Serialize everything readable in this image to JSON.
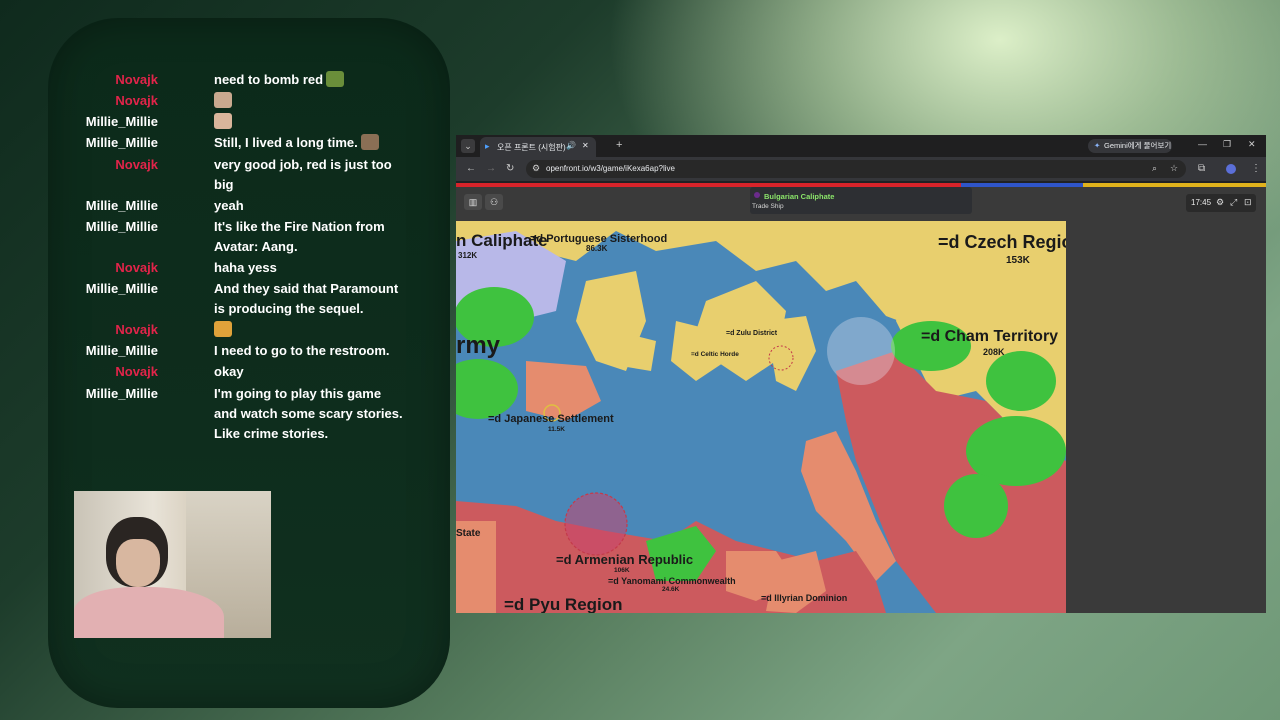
{
  "chat": {
    "messages": [
      {
        "user": "Novajk",
        "text": "need to bomb red",
        "emote": "boat-emote"
      },
      {
        "user": "Novajk",
        "text": "",
        "emote": "cat-emote"
      },
      {
        "user": "Millie_Millie",
        "text": "",
        "emote": "face-emote"
      },
      {
        "user": "Millie_Millie",
        "text": "Still, I lived a long time.",
        "emote": "dog-emote"
      },
      {
        "user": "Novajk",
        "text": "very good job, red is just too big",
        "emote": ""
      },
      {
        "user": "Millie_Millie",
        "text": "yeah",
        "emote": ""
      },
      {
        "user": "Millie_Millie",
        "text": "It's like the Fire Nation from Avatar: Aang.",
        "emote": ""
      },
      {
        "user": "Novajk",
        "text": "haha yess",
        "emote": ""
      },
      {
        "user": "Millie_Millie",
        "text": "And they said that Paramount is producing the sequel.",
        "emote": ""
      },
      {
        "user": "Novajk",
        "text": "",
        "emote": "party-emote"
      },
      {
        "user": "Millie_Millie",
        "text": "I need to go to the restroom.",
        "emote": ""
      },
      {
        "user": "Novajk",
        "text": "okay",
        "emote": ""
      },
      {
        "user": "Millie_Millie",
        "text": "I'm going to play this game and watch some scary stories. Like crime stories.",
        "emote": ""
      }
    ]
  },
  "browser": {
    "tab_title": "오픈 프론트 (시험판)",
    "new_tab_label": "+",
    "gemini_label": "Gemini에게 물어보기",
    "url": "openfront.io/w3/game/iKexa6ap?live",
    "progress_colors": [
      "#d8232a",
      "#2f55c9",
      "#e0b21c"
    ]
  },
  "game": {
    "tooltip": {
      "name": "Bulgarian Caliphate",
      "sub": "Trade Ship"
    },
    "timer": "17:45",
    "labels": [
      {
        "name": "n Caliphate",
        "value": "312K"
      },
      {
        "name": "=d Portuguese Sisterhood",
        "value": "86.3K"
      },
      {
        "name": "=d Czech Region",
        "value": "153K"
      },
      {
        "name": "=d Cham Territory",
        "value": "208K"
      },
      {
        "name": "rmy",
        "value": ""
      },
      {
        "name": "=d Zulu District",
        "value": ""
      },
      {
        "name": "=d Celtic Horde",
        "value": ""
      },
      {
        "name": "=d Japanese Settlement",
        "value": "11.5K"
      },
      {
        "name": "State",
        "value": ""
      },
      {
        "name": "=d Armenian Republic",
        "value": "106K"
      },
      {
        "name": "=d Yanomami Commonwealth",
        "value": "24.6K"
      },
      {
        "name": "=d Illyrian Dominion",
        "value": ""
      },
      {
        "name": "=d Pyu Region",
        "value": ""
      }
    ]
  },
  "colors": {
    "username_novajk": "#e2244a",
    "username_millie": "#ffffff",
    "ocean": "#4a88b8",
    "land_yellow": "#e8cf6e",
    "land_green": "#3fc23f",
    "land_red": "#cc5a5e",
    "land_salmon": "#e58c6e"
  }
}
